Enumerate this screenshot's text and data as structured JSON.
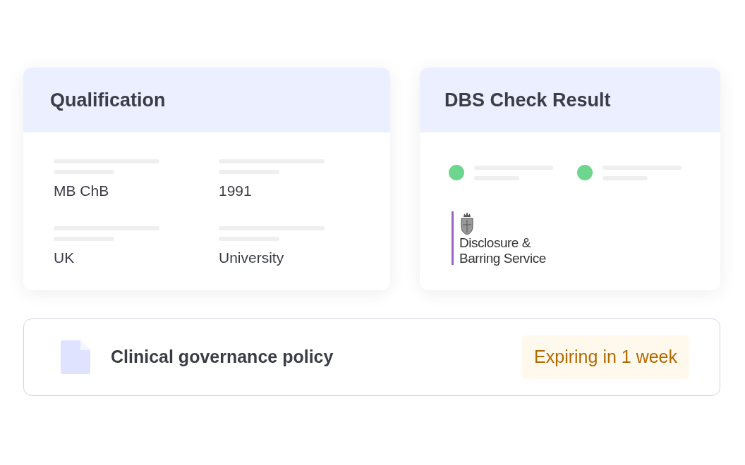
{
  "qualification": {
    "title": "Qualification",
    "fields": [
      {
        "value": "MB ChB"
      },
      {
        "value": "1991"
      },
      {
        "value": "UK"
      },
      {
        "value": "University"
      }
    ]
  },
  "dbs": {
    "title": "DBS Check Result",
    "statuses": [
      {
        "color": "#6ed58e"
      },
      {
        "color": "#6ed58e"
      }
    ],
    "logo_lines": [
      "Disclosure &",
      "Barring Service"
    ]
  },
  "document": {
    "name": "Clinical governance policy",
    "badge": "Expiring in 1 week"
  }
}
